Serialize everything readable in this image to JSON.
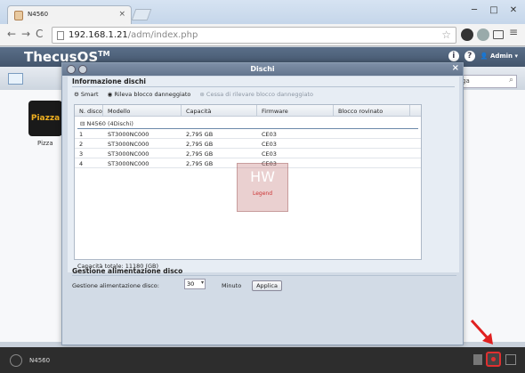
{
  "browser": {
    "tab_title": "N4560",
    "tab_close": "×",
    "url_domain": "192.168.1.21",
    "url_path": "/adm/index.php",
    "window_controls": [
      "─",
      "□",
      "✕"
    ],
    "nav": [
      "←",
      "→",
      "C"
    ]
  },
  "app": {
    "logo": "ThecusOS",
    "logo_mark": "TM",
    "user": "Admin",
    "search_placeholder": "ga"
  },
  "desktop": {
    "icon_label": "Pizza",
    "icon_text": "Piazza"
  },
  "dialog": {
    "title": "Dischi",
    "close": "×",
    "info_title": "Informazione dischi",
    "toolbar": {
      "smart": "Smart",
      "detect": "Rileva blocco danneggiato",
      "stop": "Cessa di rilevare blocco danneggiato"
    },
    "columns": [
      "N. disco",
      "Modello",
      "Capacità",
      "Firmware",
      "Blocco rovinato"
    ],
    "group": "N4560 (4Dischi)",
    "rows": [
      {
        "n": "1",
        "model": "ST3000NC000",
        "cap": "2,795 GB",
        "fw": "CE03",
        "bad": ""
      },
      {
        "n": "2",
        "model": "ST3000NC000",
        "cap": "2,795 GB",
        "fw": "CE03",
        "bad": ""
      },
      {
        "n": "3",
        "model": "ST3000NC000",
        "cap": "2,795 GB",
        "fw": "CE03",
        "bad": ""
      },
      {
        "n": "4",
        "model": "ST3000NC000",
        "cap": "2,795 GB",
        "fw": "CE03",
        "bad": ""
      }
    ],
    "capacity_total": "Capacità totale: 11180 (GB)",
    "power_title": "Gestione alimentazione disco",
    "power_label": "Gestione alimentazione disco:",
    "power_value": "30",
    "power_unit": "Minuto",
    "apply": "Applica"
  },
  "watermark": {
    "big": "HW",
    "small": "Legend"
  },
  "taskbar": {
    "label": "N4560"
  },
  "colors": {
    "header": "#4f6179",
    "accent_red": "#e03030"
  }
}
